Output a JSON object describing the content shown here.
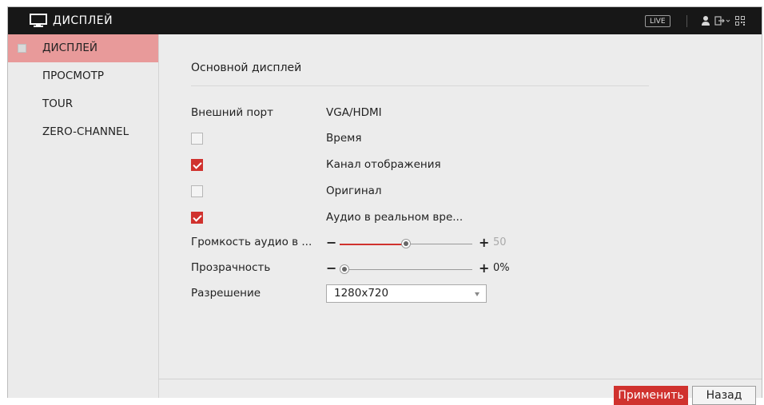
{
  "titlebar": {
    "title": "ДИСПЛЕЙ",
    "live_label": "LIVE",
    "icons": [
      "monitor-icon",
      "user-icon",
      "logout-icon",
      "qr-code-icon"
    ]
  },
  "sidebar": {
    "items": [
      {
        "label": "ДИСПЛЕЙ",
        "active": true
      },
      {
        "label": "ПРОСМОТР",
        "active": false
      },
      {
        "label": "TOUR",
        "active": false
      },
      {
        "label": "ZERO-CHANNEL",
        "active": false
      }
    ]
  },
  "main": {
    "section_title": "Основной дисплей",
    "output_port": {
      "label": "Внешний порт",
      "value": "VGA/HDMI"
    },
    "checkboxes": [
      {
        "label": "Время",
        "checked": false
      },
      {
        "label": "Канал отображения",
        "checked": true
      },
      {
        "label": "Оригинал",
        "checked": false
      },
      {
        "label": "Аудио в реальном вре...",
        "checked": true
      }
    ],
    "volume": {
      "label": "Громкость аудио в ...",
      "minus": "−",
      "plus": "+",
      "value": "50",
      "level_fraction": 0.5
    },
    "transparency": {
      "label": "Прозрачность",
      "minus": "−",
      "plus": "+",
      "value": "0%",
      "level_fraction": 0.0
    },
    "resolution": {
      "label": "Разрешение",
      "selected": "1280x720"
    }
  },
  "footer": {
    "apply_label": "Применить",
    "back_label": "Назад"
  },
  "colors": {
    "accent": "#d0322e",
    "titlebar_bg": "#171717",
    "active_item_bg": "#e89a9a",
    "panel_bg": "#ececec"
  }
}
